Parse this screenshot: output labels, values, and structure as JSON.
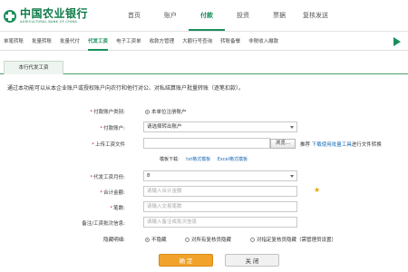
{
  "logo": {
    "name_cn": "中国农业银行",
    "name_en": "AGRICULTURAL BANK OF CHINA"
  },
  "main_nav": [
    "首页",
    "账户",
    "付款",
    "投资",
    "票据",
    "复核发送"
  ],
  "sub_nav": [
    "单笔转账",
    "批量转账",
    "批量代付",
    "代发工资",
    "电子工资单",
    "收款方管理",
    "大额行号查询",
    "转账备餐",
    "非税收入缴款"
  ],
  "tab": "本行代发工资",
  "notice": "通过本功能可以从本企业账户或授权账户向农行和他行对公、对私结算账户批量转账（逐笔扣款）。",
  "form": {
    "pay_type": {
      "label": "付款账户类别:",
      "option": "本单位注册账户"
    },
    "pay_account": {
      "label": "付款账户:",
      "value": "请选择转出账户"
    },
    "upload": {
      "label": "上传工资文件",
      "browse": "浏览...",
      "hint_prefix": "推荐",
      "hint_link": "下载使用批量工具",
      "hint_suffix": "进行文件转换"
    },
    "template": {
      "label": "模板下载:",
      "txt": "txt格式模板",
      "excel": "Excel格式模板"
    },
    "month": {
      "label": "代发工资月份:",
      "value": "8"
    },
    "amount": {
      "label": "合计金额:",
      "placeholder": "请输入合计金额"
    },
    "count": {
      "label": "笔数:",
      "placeholder": "请输入交易笔数"
    },
    "remark": {
      "label": "备注/工资批次信息:",
      "placeholder": "请输入备注或批次信息"
    },
    "hide": {
      "label": "隐藏明细:",
      "options": [
        "不隐藏",
        "对所有复核员隐藏",
        "对指定复核员隐藏（需管理员设置）"
      ]
    }
  },
  "buttons": {
    "ok": "确 定",
    "close": "关 闭"
  },
  "colors": {
    "brand_green": "#1a8f5a",
    "ok_orange": "#f0a22a",
    "link_blue": "#1a6bb5"
  }
}
